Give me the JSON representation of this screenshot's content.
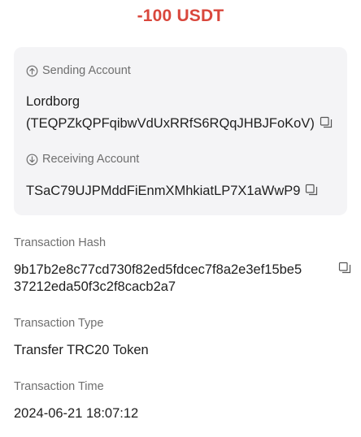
{
  "amount": "-100 USDT",
  "sending": {
    "label": "Sending Account",
    "name": "Lordborg",
    "address": "(TEQPZkQPFqibwVdUxRRfS6RQqJHBJFoKoV)"
  },
  "receiving": {
    "label": "Receiving Account",
    "address": "TSaC79UJPMddFiEnmXMhkiatLP7X1aWwP9"
  },
  "hash": {
    "label": "Transaction Hash",
    "line1": "9b17b2e8c77cd730f82ed5fdcec7f8a2e3ef15be5",
    "line2": "37212eda50f3c2f8cacb2a7"
  },
  "type": {
    "label": "Transaction Type",
    "value": "Transfer TRC20 Token"
  },
  "time": {
    "label": "Transaction Time",
    "value": "2024-06-21 18:07:12"
  },
  "icons": {
    "sending": "arrow-up-circle-icon",
    "receiving": "arrow-down-circle-icon",
    "copy": "copy-icon"
  },
  "colors": {
    "amount": "#d9473c",
    "card_bg": "#f4f4f6",
    "label": "#6f6f6f",
    "text": "#1f1f1f"
  }
}
